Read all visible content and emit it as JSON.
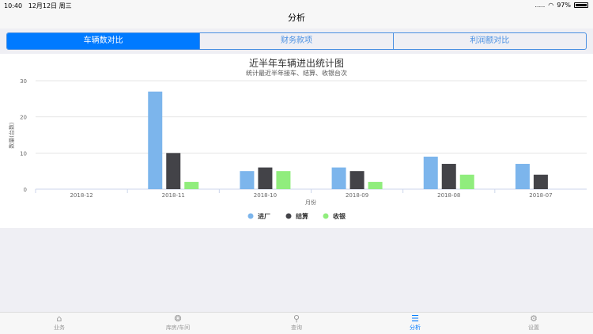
{
  "status": {
    "time": "10:40",
    "date": "12月12日 周三",
    "battery": "97%",
    "signal": "....."
  },
  "nav": {
    "title": "分析"
  },
  "segments": [
    {
      "label": "车辆数对比",
      "active": true
    },
    {
      "label": "财务款项",
      "active": false
    },
    {
      "label": "利润额对比",
      "active": false
    }
  ],
  "chart_data": {
    "type": "bar",
    "title": "近半年车辆进出统计图",
    "subtitle": "统计最近半年接车、结算、收银台次",
    "xlabel": "月份",
    "ylabel": "数量(台数)",
    "ylim": [
      0,
      30
    ],
    "yticks": [
      0,
      10,
      20,
      30
    ],
    "categories": [
      "2018-12",
      "2018-11",
      "2018-10",
      "2018-09",
      "2018-08",
      "2018-07"
    ],
    "series": [
      {
        "name": "进厂",
        "color": "#7cb5ec",
        "values": [
          0,
          27,
          5,
          6,
          9,
          7
        ]
      },
      {
        "name": "结算",
        "color": "#434348",
        "values": [
          0,
          10,
          6,
          5,
          7,
          4
        ]
      },
      {
        "name": "收银",
        "color": "#90ed7d",
        "values": [
          0,
          2,
          5,
          2,
          4,
          0
        ]
      }
    ],
    "legend": "bottom-center",
    "grid": true
  },
  "tabbar": [
    {
      "label": "业务",
      "icon": "home-icon"
    },
    {
      "label": "库房/车间",
      "icon": "aperture-icon"
    },
    {
      "label": "查询",
      "icon": "search-icon"
    },
    {
      "label": "分析",
      "icon": "list-icon",
      "active": true
    },
    {
      "label": "设置",
      "icon": "gear-icon"
    }
  ]
}
